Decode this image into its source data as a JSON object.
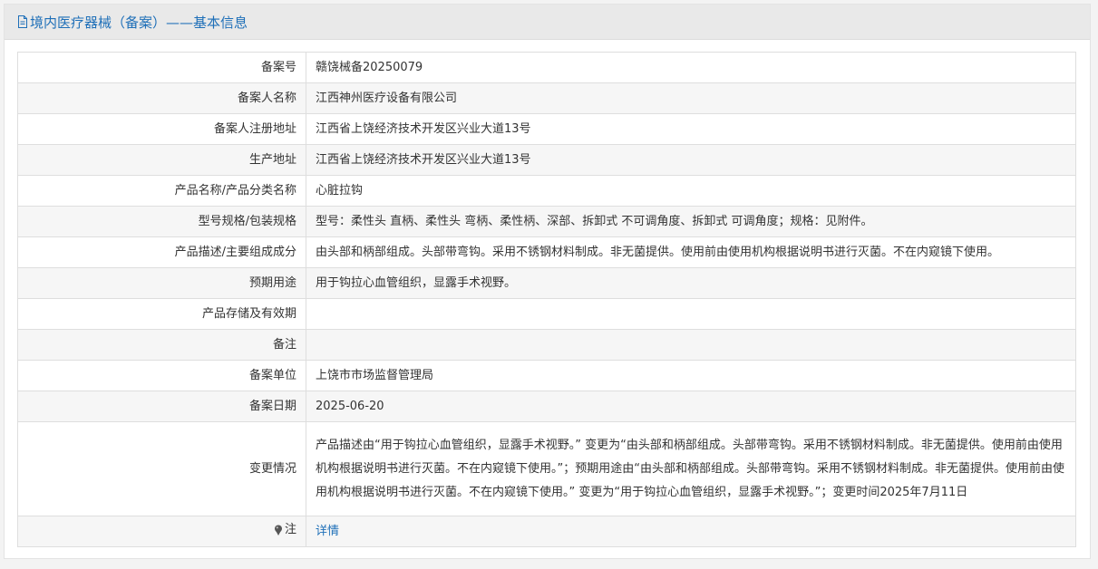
{
  "header": {
    "title": "境内医疗器械（备案）——基本信息"
  },
  "rows": [
    {
      "label": "备案号",
      "value": "赣饶械备20250079"
    },
    {
      "label": "备案人名称",
      "value": "江西神州医疗设备有限公司"
    },
    {
      "label": "备案人注册地址",
      "value": "江西省上饶经济技术开发区兴业大道13号"
    },
    {
      "label": "生产地址",
      "value": "江西省上饶经济技术开发区兴业大道13号"
    },
    {
      "label": "产品名称/产品分类名称",
      "value": "心脏拉钩"
    },
    {
      "label": "型号规格/包装规格",
      "value": "型号：柔性头 直柄、柔性头 弯柄、柔性柄、深部、拆卸式 不可调角度、拆卸式 可调角度；规格：见附件。"
    },
    {
      "label": "产品描述/主要组成成分",
      "value": "由头部和柄部组成。头部带弯钩。采用不锈钢材料制成。非无菌提供。使用前由使用机构根据说明书进行灭菌。不在内窥镜下使用。"
    },
    {
      "label": "预期用途",
      "value": "用于钩拉心血管组织，显露手术视野。"
    },
    {
      "label": "产品存储及有效期",
      "value": ""
    },
    {
      "label": "备注",
      "value": ""
    },
    {
      "label": "备案单位",
      "value": "上饶市市场监督管理局"
    },
    {
      "label": "备案日期",
      "value": "2025-06-20"
    }
  ],
  "change": {
    "label": "变更情况",
    "value": "产品描述由“用于钩拉心血管组织，显露手术视野。” 变更为“由头部和柄部组成。头部带弯钩。采用不锈钢材料制成。非无菌提供。使用前由使用机构根据说明书进行灭菌。不在内窥镜下使用。”；预期用途由“由头部和柄部组成。头部带弯钩。采用不锈钢材料制成。非无菌提供。使用前由使用机构根据说明书进行灭菌。不在内窥镜下使用。” 变更为“用于钩拉心血管组织，显露手术视野。”；变更时间2025年7月11日"
  },
  "note": {
    "label": "注",
    "icon": "pin-icon",
    "link_text": "详情"
  },
  "colors": {
    "accent": "#1e6fb8",
    "header_bg": "#e9e9e9",
    "stripe_bg": "#f6f6f6"
  }
}
